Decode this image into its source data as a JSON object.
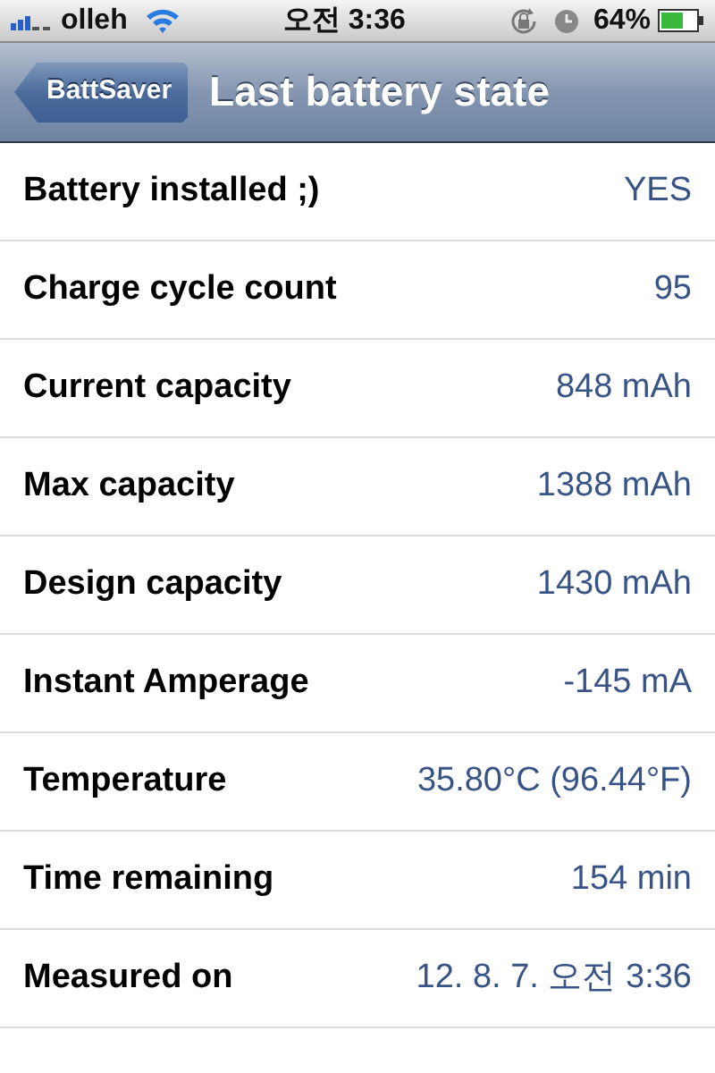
{
  "status_bar": {
    "carrier": "olleh",
    "time": "오전 3:36",
    "battery_percent": "64%"
  },
  "nav_bar": {
    "back_button": "BattSaver",
    "title": "Last battery state"
  },
  "rows": [
    {
      "label": "Battery installed ;)",
      "value": "YES"
    },
    {
      "label": "Charge cycle count",
      "value": "95"
    },
    {
      "label": "Current capacity",
      "value": "848 mAh"
    },
    {
      "label": "Max capacity",
      "value": "1388 mAh"
    },
    {
      "label": "Design capacity",
      "value": "1430 mAh"
    },
    {
      "label": "Instant Amperage",
      "value": "-145 mA"
    },
    {
      "label": "Temperature",
      "value": "35.80°C (96.44°F)"
    },
    {
      "label": "Time remaining",
      "value": "154 min"
    },
    {
      "label": "Measured on",
      "value": "12. 8. 7. 오전 3:36"
    }
  ]
}
